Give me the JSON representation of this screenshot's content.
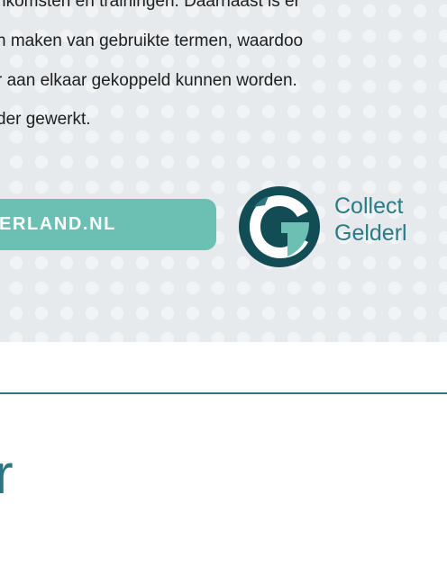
{
  "intro": {
    "lines": [
      "nkomsten en trainingen. Daarnaast is er",
      "n maken van gebruikte termen, waardoo",
      "r aan elkaar gekoppeld kunnen worden.",
      "der gewerkt."
    ]
  },
  "cta": {
    "label": "ERLAND.NL"
  },
  "logo": {
    "name_line1": "Collect",
    "name_line2": "Gelderl",
    "icon": "collectie-gelderland-logo-icon"
  },
  "heading": {
    "text": "r"
  },
  "colors": {
    "panel_background": "#e6eaec",
    "button": "#6bbfb3",
    "brand_teal": "#2d7580",
    "logo_dark": "#124c55",
    "logo_accent": "#6bbfb3"
  }
}
